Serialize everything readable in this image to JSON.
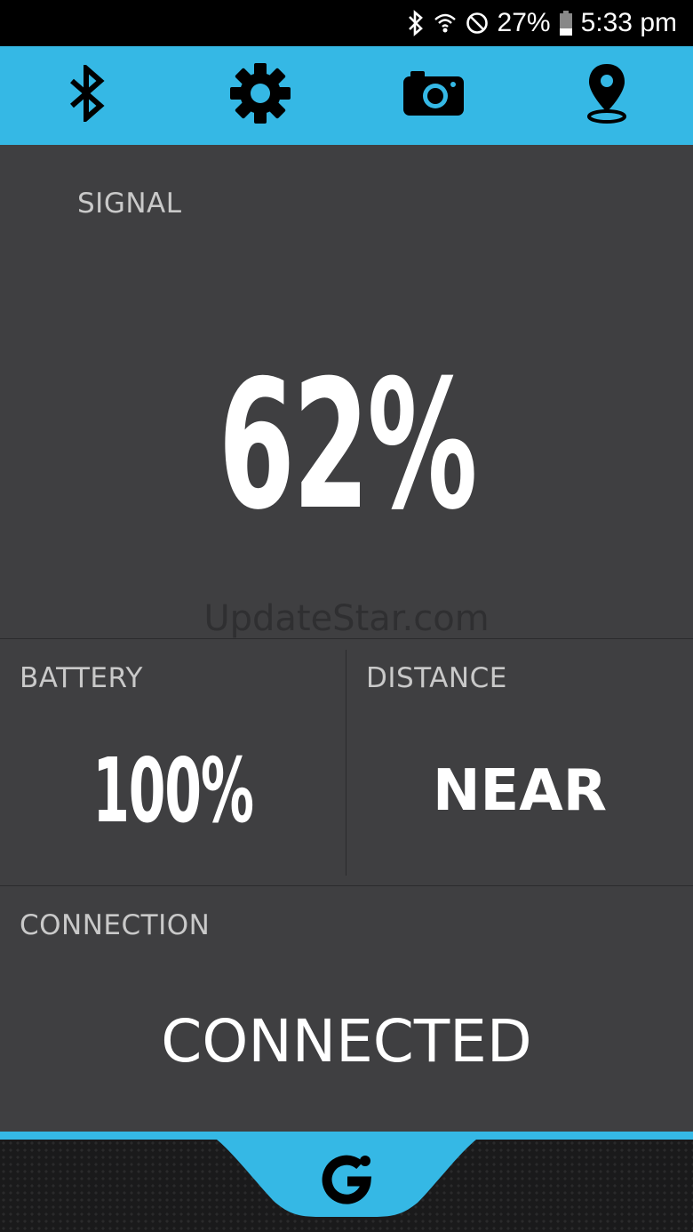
{
  "status_bar": {
    "battery_percent": "27%",
    "time": "5:33 pm",
    "icons": [
      "bluetooth-icon",
      "wifi-icon",
      "do-not-disturb-icon",
      "battery-icon"
    ]
  },
  "toolbar": {
    "items": [
      {
        "name": "bluetooth-icon"
      },
      {
        "name": "gear-icon"
      },
      {
        "name": "camera-icon"
      },
      {
        "name": "location-pin-icon"
      }
    ],
    "color": "#35b8e5"
  },
  "signal": {
    "label": "SIGNAL",
    "value": "62%"
  },
  "watermark": "UpdateStar.com",
  "battery": {
    "label": "BATTERY",
    "value": "100%"
  },
  "distance": {
    "label": "DISTANCE",
    "value": "NEAR"
  },
  "connection": {
    "label": "CONNECTION",
    "value": "CONNECTED"
  },
  "footer": {
    "logo": "g-logo-icon"
  }
}
